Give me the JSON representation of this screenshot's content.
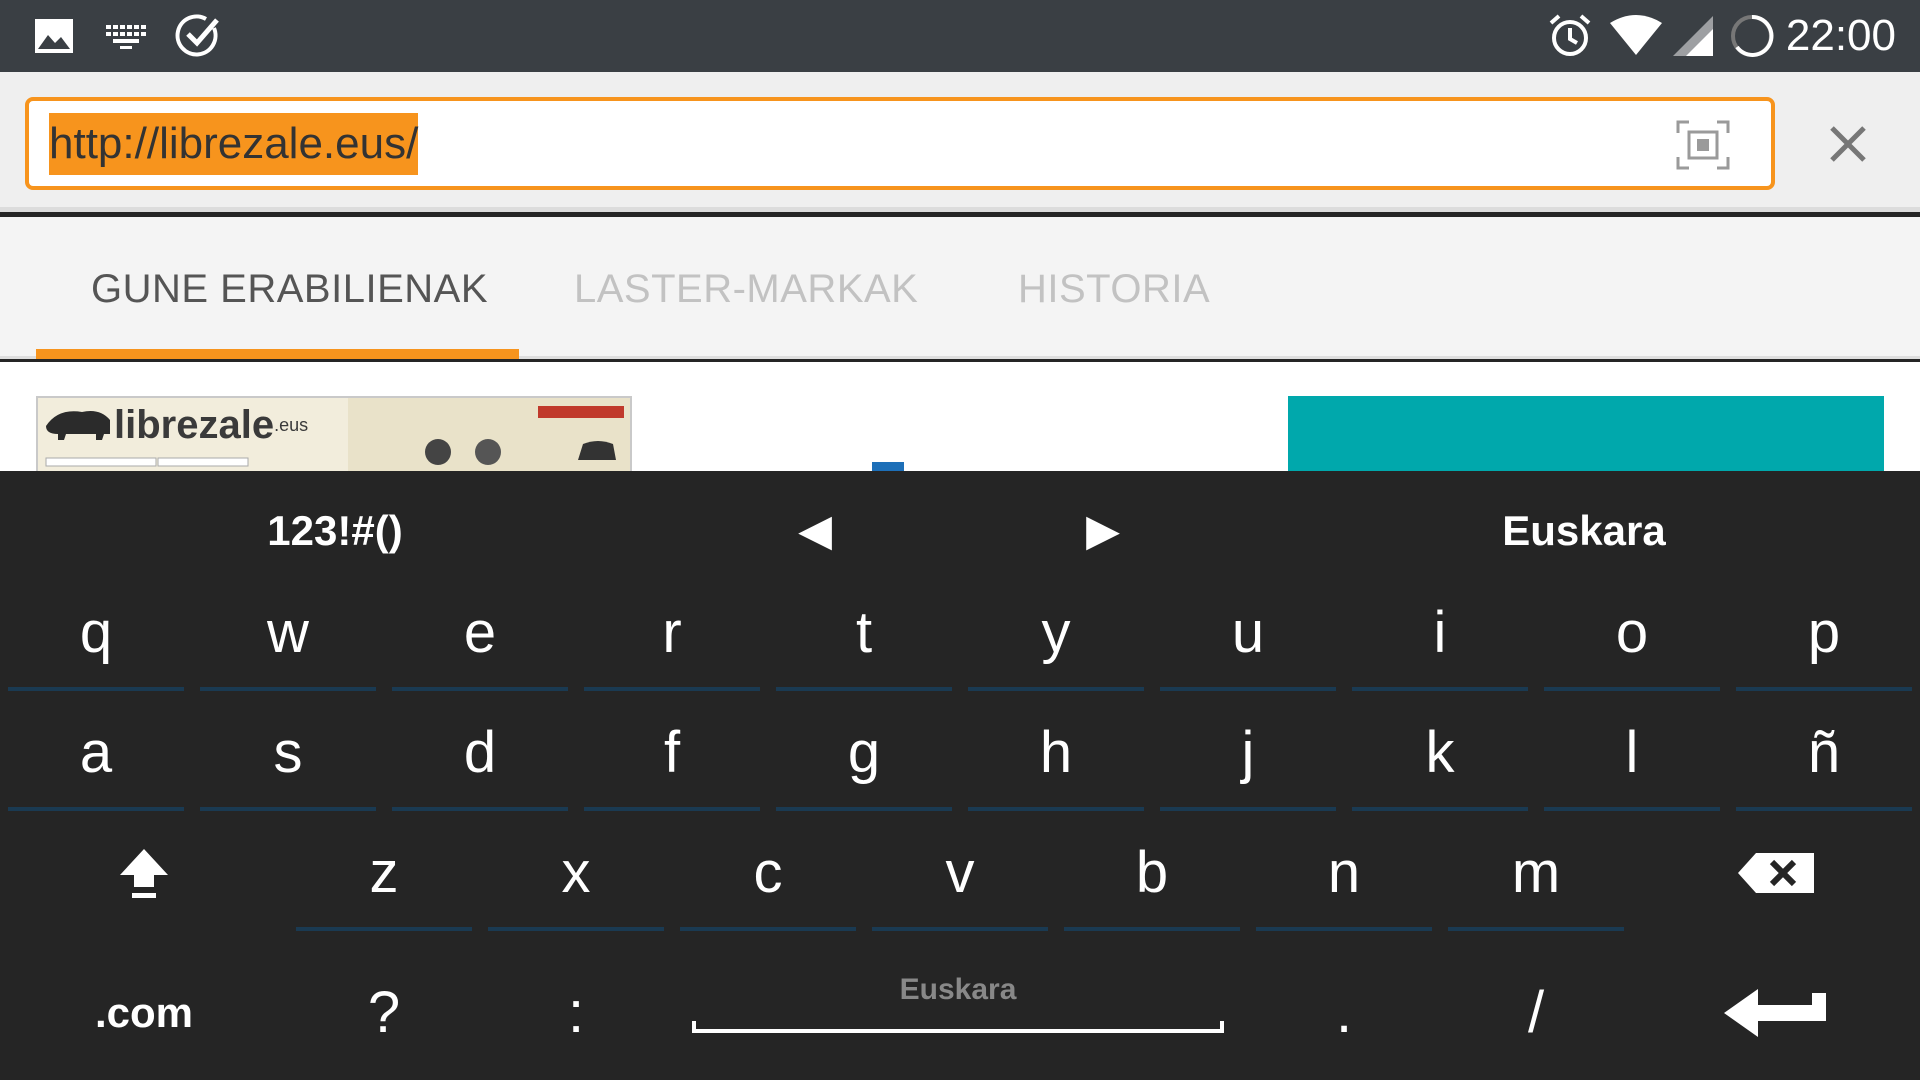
{
  "status_bar": {
    "time": "22:00",
    "left_icons": [
      "image-icon",
      "keyboard-icon",
      "check-circle-icon"
    ],
    "right_icons": [
      "alarm-icon",
      "wifi-icon",
      "signal-icon",
      "battery-icon"
    ]
  },
  "url_bar": {
    "url": "http://librezale.eus/"
  },
  "tabs": [
    {
      "label": "GUNE ERABILIENAK",
      "active": true
    },
    {
      "label": "LASTER-MARKAK",
      "active": false
    },
    {
      "label": "HISTORIA",
      "active": false
    }
  ],
  "content": {
    "thumbnail_title": "librezale",
    "thumbnail_suffix": ".eus"
  },
  "keyboard": {
    "top_row": {
      "symbols": "123!#()",
      "left_arrow": "◀",
      "right_arrow": "▶",
      "language": "Euskara"
    },
    "row1": [
      "q",
      "w",
      "e",
      "r",
      "t",
      "y",
      "u",
      "i",
      "o",
      "p"
    ],
    "row2": [
      "a",
      "s",
      "d",
      "f",
      "g",
      "h",
      "j",
      "k",
      "l",
      "ñ"
    ],
    "row3": [
      "z",
      "x",
      "c",
      "v",
      "b",
      "n",
      "m"
    ],
    "row4": {
      "dotcom": ".com",
      "question": "?",
      "colon": ":",
      "space_label": "Euskara",
      "period": ".",
      "slash": "/"
    }
  },
  "colors": {
    "accent": "#f7941d",
    "status_bar": "#3a3f44",
    "keyboard_bg": "#252525",
    "teal": "#00a8ac"
  }
}
